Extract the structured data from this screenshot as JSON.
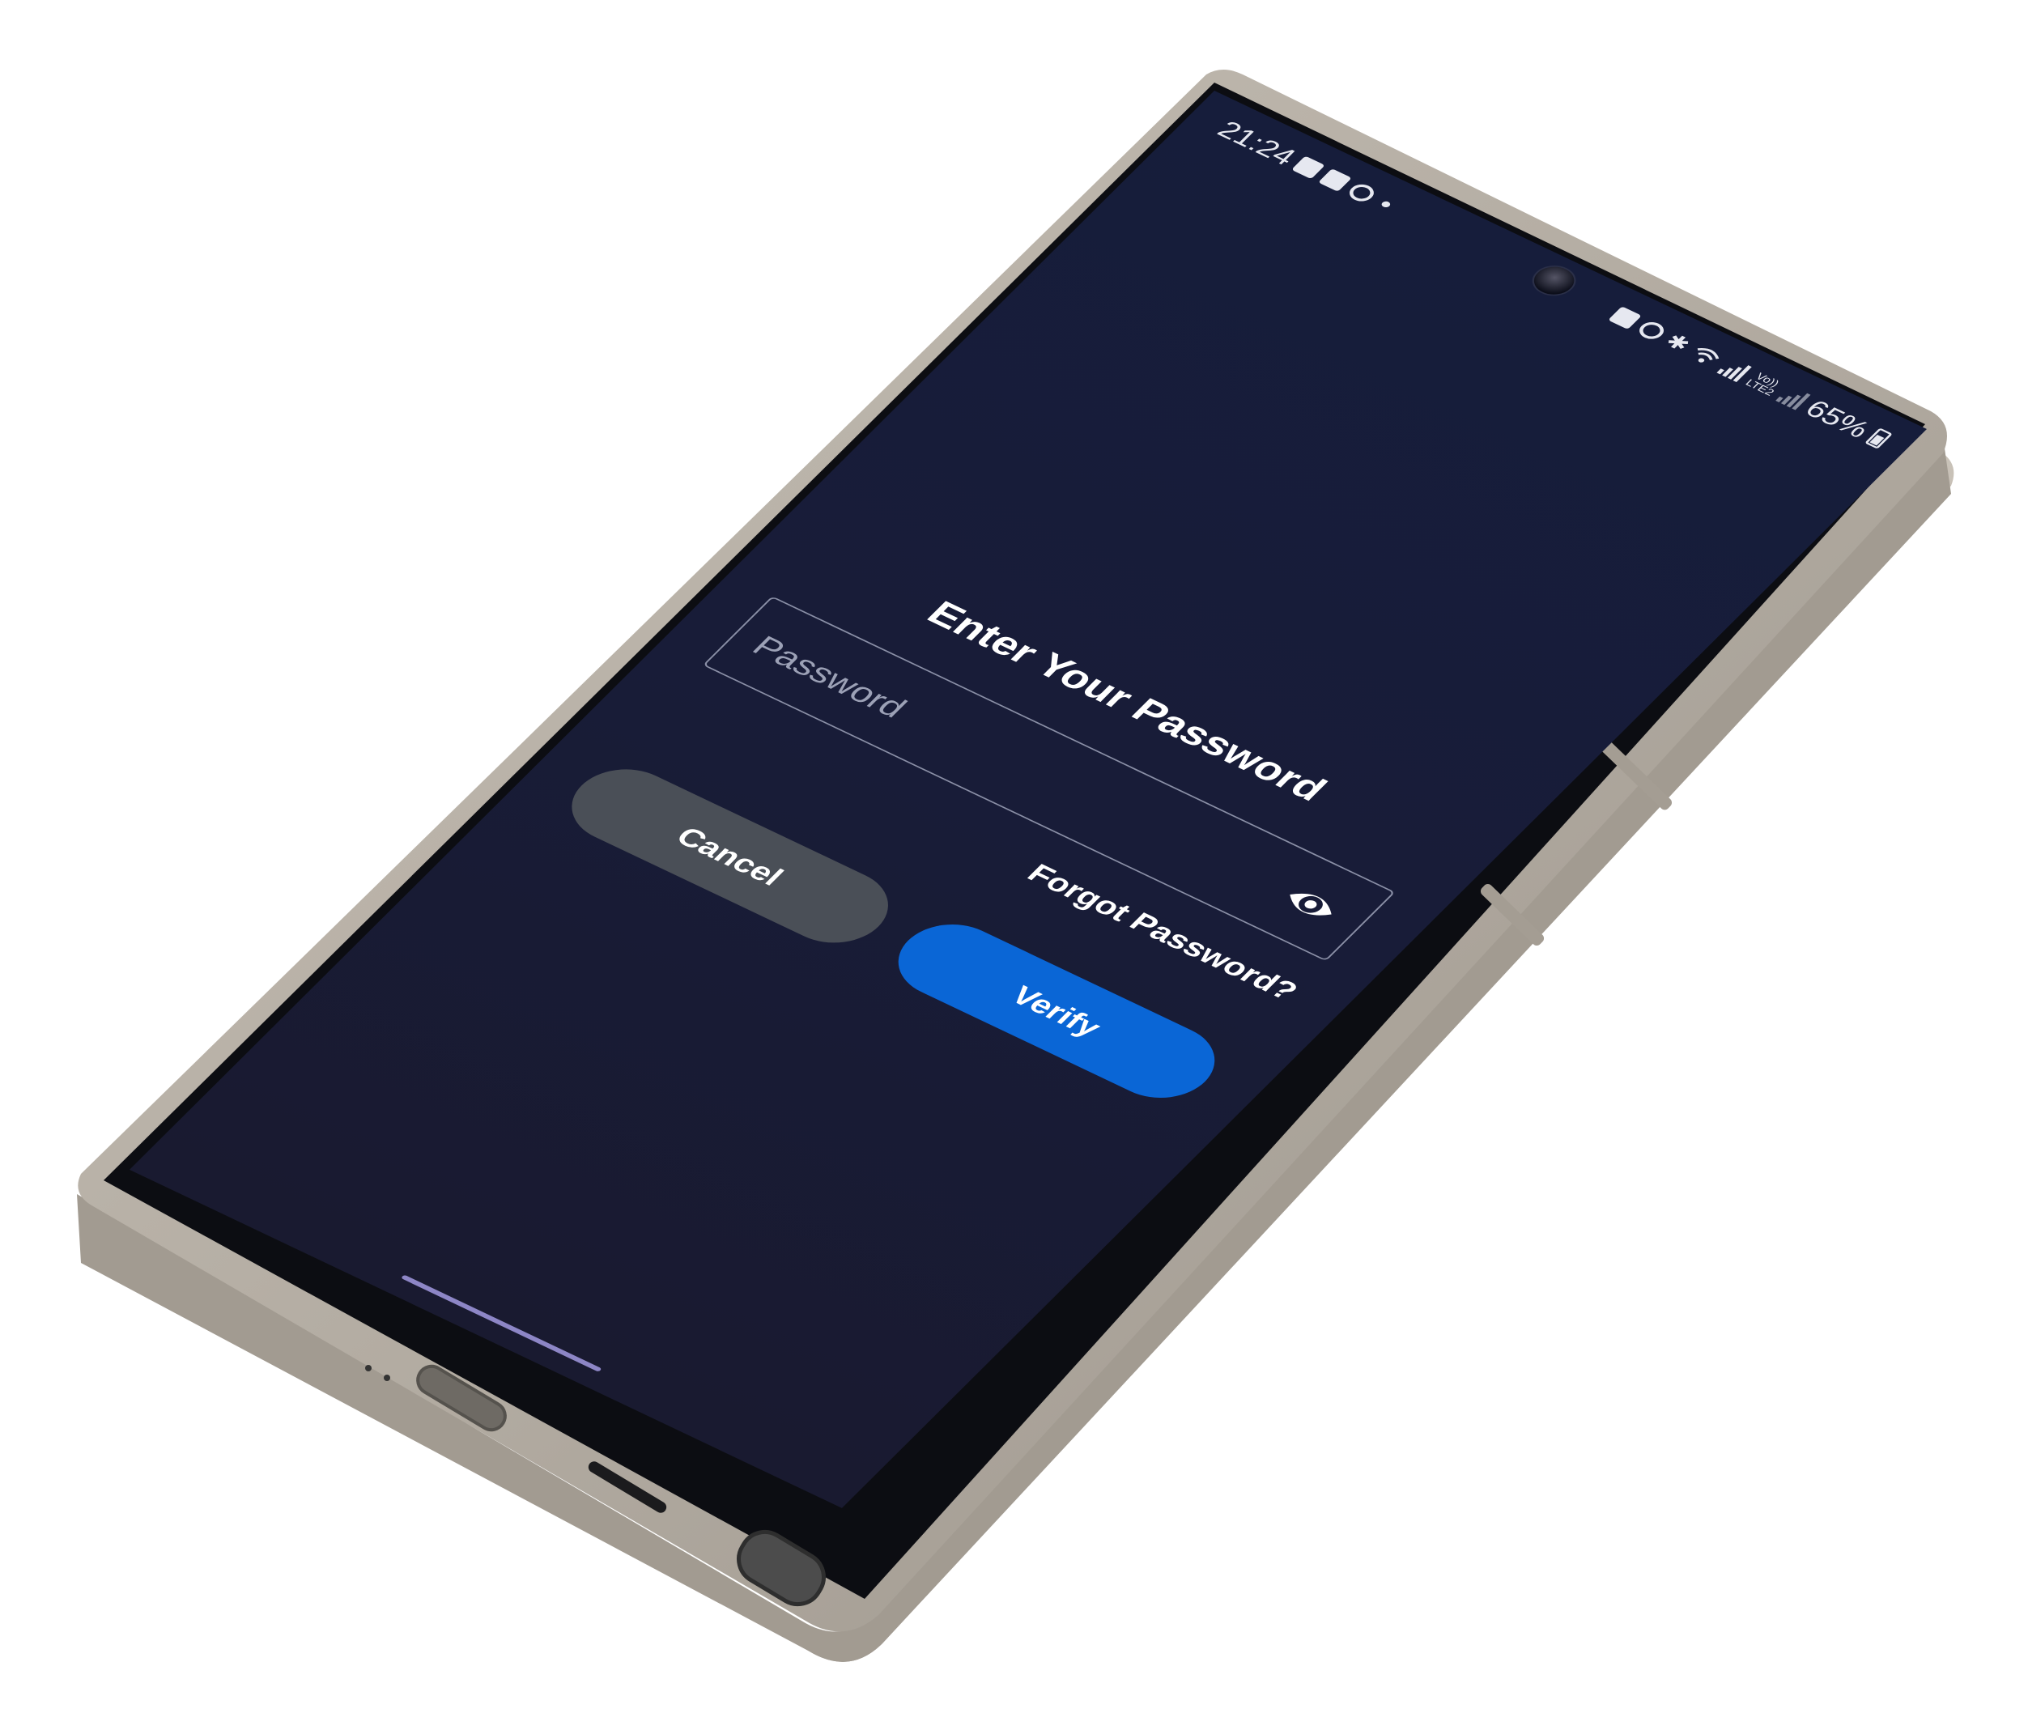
{
  "status_bar": {
    "time": "21:24",
    "left_icons": [
      "gallery-icon",
      "app-icon",
      "whatsapp-icon",
      "notification-dot-icon"
    ],
    "right_icons": [
      "battery-saver-icon",
      "alarm-icon",
      "bluetooth-icon",
      "wifi-icon",
      "signal-icon",
      "volte-lte2-icon",
      "signal-icon"
    ],
    "volte_label": "Vo))",
    "lte_label": "LTE2",
    "battery_percent": "65%"
  },
  "dialog": {
    "title": "Enter Your Password",
    "password_placeholder": "Password",
    "password_value": "",
    "forgot_password_label": "Forgot Password?",
    "cancel_label": "Cancel",
    "verify_label": "Verify"
  },
  "colors": {
    "background": "#181c38",
    "accent": "#0a66d6",
    "cancel_button": "#4a4f57",
    "field_border": "#8a8fa6",
    "home_indicator": "#8d86c6"
  }
}
